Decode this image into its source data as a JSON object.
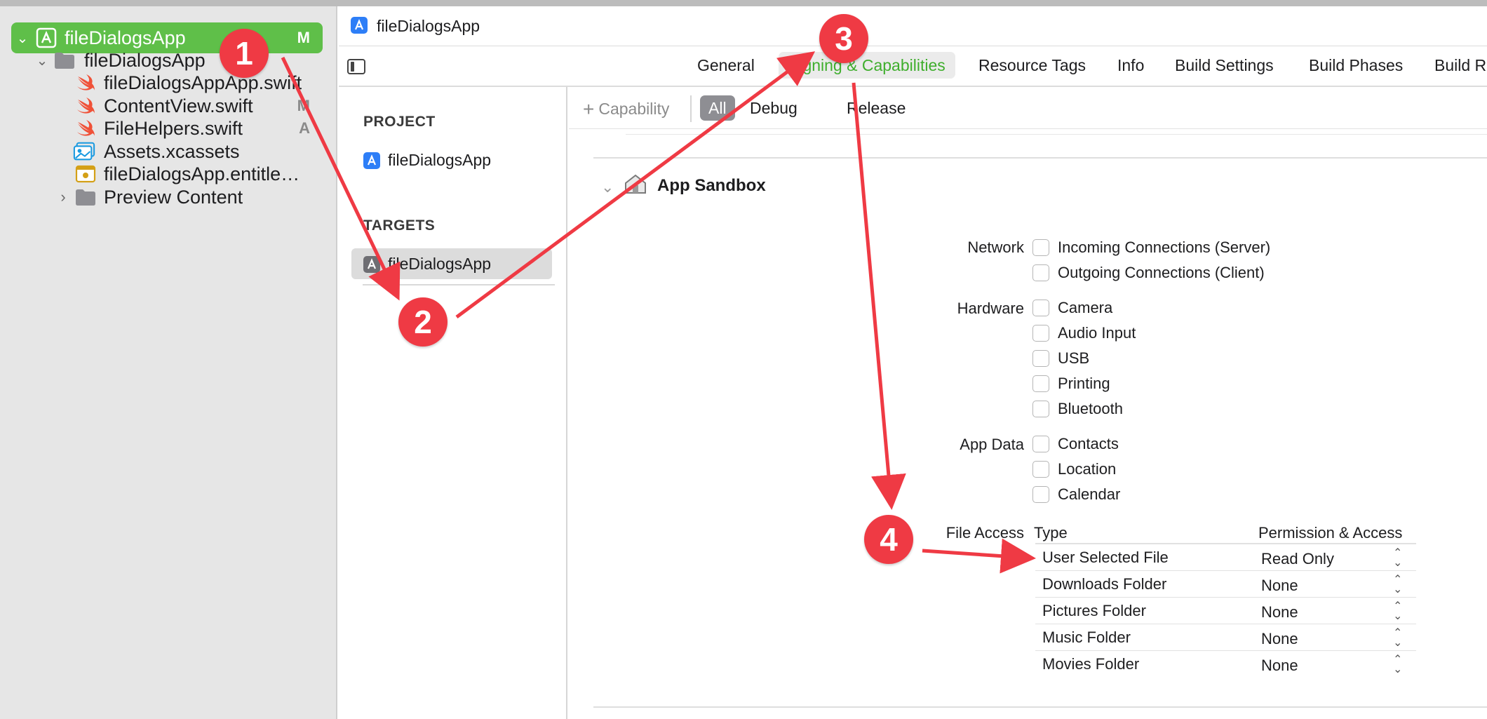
{
  "sidebar": {
    "root": {
      "label": "fileDialogsApp",
      "badge": "M"
    },
    "folder": {
      "label": "fileDialogsApp"
    },
    "files": [
      {
        "label": "fileDialogsAppApp.swift",
        "badge": "",
        "icon": "swift-icon"
      },
      {
        "label": "ContentView.swift",
        "badge": "M",
        "icon": "swift-icon"
      },
      {
        "label": "FileHelpers.swift",
        "badge": "A",
        "icon": "swift-icon"
      },
      {
        "label": "Assets.xcassets",
        "badge": "",
        "icon": "assets-icon"
      },
      {
        "label": "fileDialogsApp.entitle…",
        "badge": "",
        "icon": "entitlements-icon"
      }
    ],
    "preview": {
      "label": "Preview Content"
    }
  },
  "header": {
    "title": "fileDialogsApp"
  },
  "tabs": [
    "General",
    "Signing & Capabilities",
    "Resource Tags",
    "Info",
    "Build Settings",
    "Build Phases",
    "Build R"
  ],
  "project_panel": {
    "project_heading": "PROJECT",
    "project_item": "fileDialogsApp",
    "targets_heading": "TARGETS",
    "target_item": "fileDialogsApp"
  },
  "filter": {
    "capability_label": "Capability",
    "pills": [
      "All",
      "Debug",
      "Release"
    ]
  },
  "sandbox": {
    "title": "App Sandbox",
    "network_label": "Network",
    "network": [
      "Incoming Connections (Server)",
      "Outgoing Connections (Client)"
    ],
    "hardware_label": "Hardware",
    "hardware": [
      "Camera",
      "Audio Input",
      "USB",
      "Printing",
      "Bluetooth"
    ],
    "appdata_label": "App Data",
    "appdata": [
      "Contacts",
      "Location",
      "Calendar"
    ],
    "file_access_label": "File Access",
    "type_header": "Type",
    "permission_header": "Permission & Access",
    "file_access_rows": [
      {
        "type": "User Selected File",
        "permission": "Read Only"
      },
      {
        "type": "Downloads Folder",
        "permission": "None"
      },
      {
        "type": "Pictures Folder",
        "permission": "None"
      },
      {
        "type": "Music Folder",
        "permission": "None"
      },
      {
        "type": "Movies Folder",
        "permission": "None"
      }
    ]
  },
  "annotations": {
    "steps": [
      "1",
      "2",
      "3",
      "4"
    ],
    "color": "#ef3a44"
  },
  "colors": {
    "accent_green": "#5fbf49",
    "active_tab_text": "#3fae2d",
    "swift_orange": "#f05138"
  }
}
